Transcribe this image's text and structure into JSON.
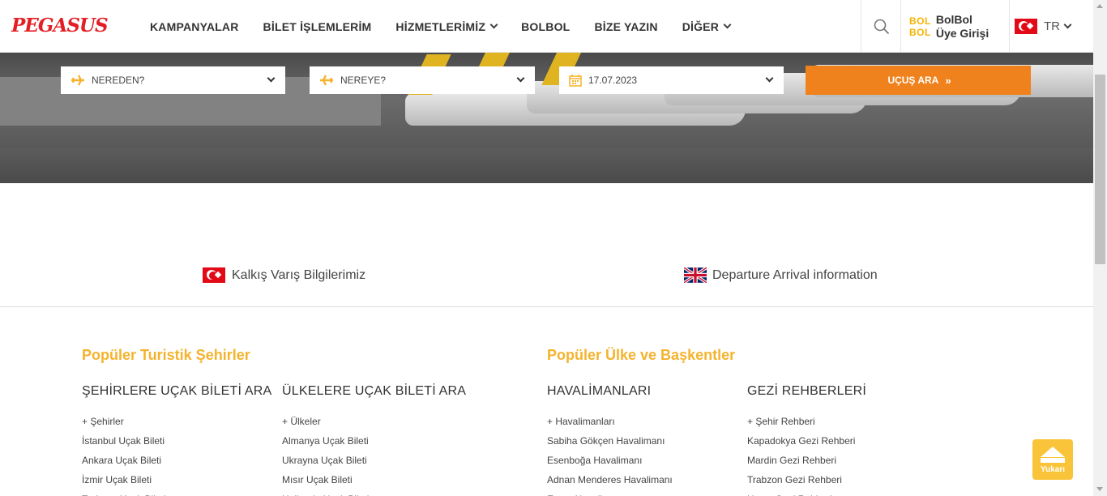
{
  "header": {
    "logo": "PEGASUS",
    "nav": [
      {
        "label": "KAMPANYALAR",
        "dropdown": false
      },
      {
        "label": "BİLET İŞLEMLERİM",
        "dropdown": false
      },
      {
        "label": "HİZMETLERİMİZ",
        "dropdown": true
      },
      {
        "label": "BOLBOL",
        "dropdown": false
      },
      {
        "label": "BİZE YAZIN",
        "dropdown": false
      },
      {
        "label": "DİĞER",
        "dropdown": true
      }
    ],
    "search_icon": "search-icon",
    "bolbol": {
      "mark_top": "BOL",
      "mark_bottom": "BOL",
      "line1": "BolBol",
      "line2": "Üye Girişi"
    },
    "language": {
      "code": "TR",
      "flag": "turkey-flag-icon"
    }
  },
  "search": {
    "from": {
      "label": "NEREDEN?",
      "icon": "plane-takeoff-icon"
    },
    "to": {
      "label": "NEREYE?",
      "icon": "plane-landing-icon"
    },
    "date": {
      "value": "17.07.2023",
      "icon": "calendar-icon"
    },
    "button": "UÇUŞ ARA",
    "button_arrow": "»",
    "accent": "#f0821e"
  },
  "info_links": {
    "tr": "Kalkış Varış Bilgilerimiz",
    "en": "Departure Arrival information"
  },
  "footer": {
    "section_left": "Popüler Turistik Şehirler",
    "section_right": "Popüler Ülke ve Başkentler",
    "title_color": "#f5b32d",
    "columns": [
      {
        "heading": "ŞEHİRLERE UÇAK BİLETİ ARA",
        "links": [
          "+ Şehirler",
          "İstanbul Uçak Bileti",
          "Ankara Uçak Bileti",
          "İzmir Uçak Bileti",
          "Trabzon Uçak Bileti"
        ]
      },
      {
        "heading": "ÜLKELERE UÇAK BİLETİ ARA",
        "links": [
          "+ Ülkeler",
          "Almanya Uçak Bileti",
          "Ukrayna Uçak Bileti",
          "Mısır Uçak Bileti",
          "Hollanda Uçak Bileti"
        ]
      },
      {
        "heading": "HAVALİMANLARI",
        "links": [
          "+ Havalimanları",
          "Sabiha Gökçen Havalimanı",
          "Esenboğa Havalimanı",
          "Adnan Menderes Havalimanı",
          "Ercan Havalimanı"
        ]
      },
      {
        "heading": "GEZİ REHBERLERİ",
        "links": [
          "+ Şehir Rehberi",
          "Kapadokya Gezi Rehberi",
          "Mardin Gezi Rehberi",
          "Trabzon Gezi Rehberi",
          "Hatay Gezi Rehberi"
        ]
      }
    ]
  },
  "back_to_top": {
    "label": "Yukarı",
    "icon": "arrow-up-icon"
  }
}
